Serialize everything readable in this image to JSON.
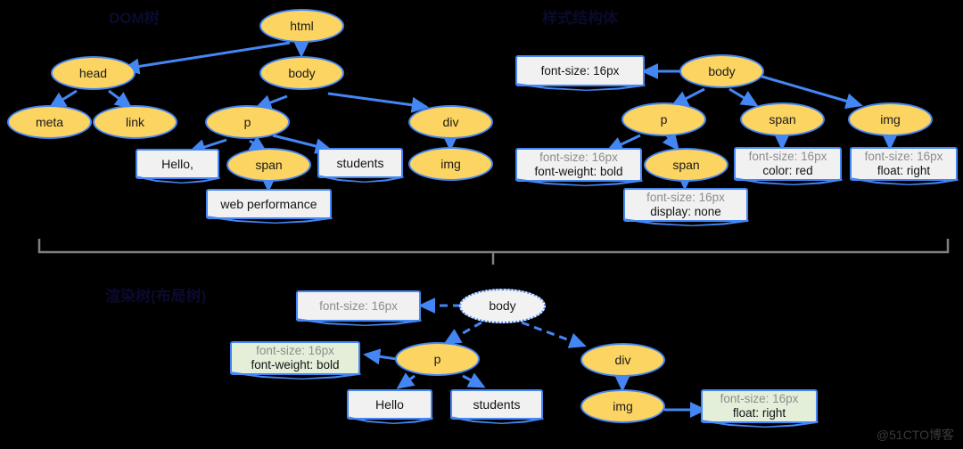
{
  "meta": {
    "background": "#000000",
    "node_fill": "#fcd462",
    "node_stroke": "#4486f4",
    "box_fill": "#f1f1f1",
    "box_fill_green": "#e3efd9",
    "dim_text": "#8d8d8d",
    "watermark": "@51CTO博客"
  },
  "sections": {
    "dom_tree": {
      "title": "DOM树"
    },
    "style_tree": {
      "title": "样式结构体"
    },
    "render_tree": {
      "title": "渲染树(布局树)"
    }
  },
  "dom_tree": {
    "nodes": [
      {
        "id": "html",
        "label": "html",
        "shape": "ellipse"
      },
      {
        "id": "head",
        "label": "head",
        "shape": "ellipse"
      },
      {
        "id": "body",
        "label": "body",
        "shape": "ellipse"
      },
      {
        "id": "meta",
        "label": "meta",
        "shape": "ellipse"
      },
      {
        "id": "link",
        "label": "link",
        "shape": "ellipse"
      },
      {
        "id": "p",
        "label": "p",
        "shape": "ellipse"
      },
      {
        "id": "div",
        "label": "div",
        "shape": "ellipse"
      },
      {
        "id": "hello",
        "label": "Hello,",
        "shape": "box"
      },
      {
        "id": "span",
        "label": "span",
        "shape": "ellipse"
      },
      {
        "id": "students",
        "label": "students",
        "shape": "box"
      },
      {
        "id": "img",
        "label": "img",
        "shape": "ellipse"
      },
      {
        "id": "webperf",
        "label": "web performance",
        "shape": "box"
      }
    ]
  },
  "style_tree": {
    "nodes": [
      {
        "id": "s-body",
        "label": "body",
        "shape": "ellipse"
      },
      {
        "id": "s-p",
        "label": "p",
        "shape": "ellipse"
      },
      {
        "id": "s-span1",
        "label": "span",
        "shape": "ellipse"
      },
      {
        "id": "s-span2",
        "label": "span",
        "shape": "ellipse"
      },
      {
        "id": "s-img",
        "label": "img",
        "shape": "ellipse"
      }
    ],
    "style_boxes": [
      {
        "id": "sb-body",
        "lines": [
          {
            "text": "font-size: 16px",
            "dim": false
          }
        ]
      },
      {
        "id": "sb-p",
        "lines": [
          {
            "text": "font-size: 16px",
            "dim": true
          },
          {
            "text": "font-weight: bold",
            "dim": false
          }
        ]
      },
      {
        "id": "sb-span1",
        "lines": [
          {
            "text": "font-size: 16px",
            "dim": true
          },
          {
            "text": "display: none",
            "dim": false
          }
        ]
      },
      {
        "id": "sb-span2",
        "lines": [
          {
            "text": "font-size: 16px",
            "dim": true
          },
          {
            "text": "color: red",
            "dim": false
          }
        ]
      },
      {
        "id": "sb-img",
        "lines": [
          {
            "text": "font-size: 16px",
            "dim": true
          },
          {
            "text": "float: right",
            "dim": false
          }
        ]
      }
    ]
  },
  "render_tree": {
    "nodes": [
      {
        "id": "r-body",
        "label": "body",
        "shape": "ellipse-ghost"
      },
      {
        "id": "r-p",
        "label": "p",
        "shape": "ellipse"
      },
      {
        "id": "r-div",
        "label": "div",
        "shape": "ellipse"
      },
      {
        "id": "r-img",
        "label": "img",
        "shape": "ellipse"
      },
      {
        "id": "r-hello",
        "label": "Hello",
        "shape": "box"
      },
      {
        "id": "r-students",
        "label": "students",
        "shape": "box"
      }
    ],
    "style_boxes": [
      {
        "id": "rb-body",
        "green": false,
        "lines": [
          {
            "text": "font-size: 16px",
            "dim": true
          }
        ]
      },
      {
        "id": "rb-p",
        "green": true,
        "lines": [
          {
            "text": "font-size: 16px",
            "dim": true
          },
          {
            "text": "font-weight: bold",
            "dim": false
          }
        ]
      },
      {
        "id": "rb-img",
        "green": true,
        "lines": [
          {
            "text": "font-size: 16px",
            "dim": true
          },
          {
            "text": "float: right",
            "dim": false
          }
        ]
      }
    ]
  }
}
